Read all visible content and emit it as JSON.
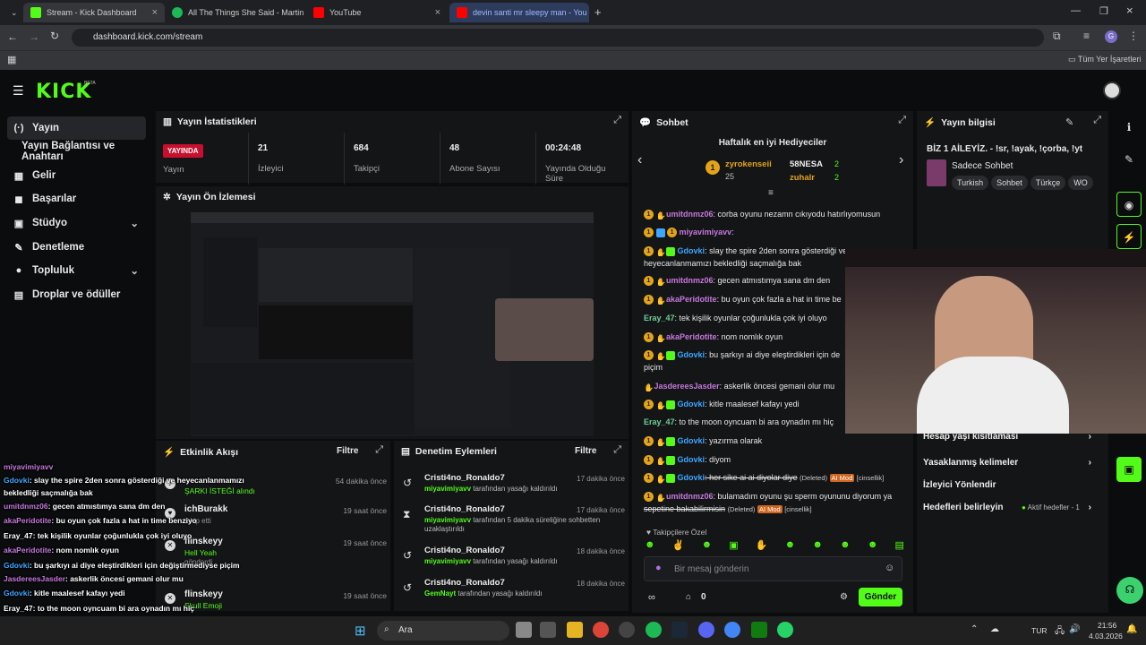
{
  "browser": {
    "tabs": [
      {
        "title": "Stream - Kick Dashboard",
        "color": "#53fc18"
      },
      {
        "title": "All The Things She Said - Martin",
        "color": "#1db954"
      },
      {
        "title": "YouTube",
        "color": "#ff0000"
      },
      {
        "title": "devin santi mr sleepy man - You",
        "color": "#ff0000"
      }
    ],
    "url": "dashboard.kick.com/stream",
    "bookmarks_label": "Tüm Yer İşaretleri",
    "profile_initial": "G"
  },
  "kick": {
    "logo": "KICK",
    "beta": "BETA"
  },
  "sidebar": {
    "items": [
      {
        "label": "Yayın",
        "icon": "(o)"
      },
      {
        "label": "Yayın Bağlantısı ve Anahtarı",
        "icon": ""
      },
      {
        "label": "Gelir",
        "icon": "▦"
      },
      {
        "label": "Başarılar",
        "icon": "◼"
      },
      {
        "label": "Stüdyo",
        "icon": "▣"
      },
      {
        "label": "Denetleme",
        "icon": "🔧"
      },
      {
        "label": "Topluluk",
        "icon": "●"
      },
      {
        "label": "Droplar ve ödüller",
        "icon": "▤"
      }
    ]
  },
  "stats": {
    "title": "Yayın İstatistikleri",
    "live_badge": "YAYINDA",
    "live_label": "Yayın",
    "viewers": "21",
    "viewers_label": "İzleyici",
    "followers": "684",
    "followers_label": "Takipçi",
    "subs": "48",
    "subs_label": "Abone Sayısı",
    "duration": "00:24:48",
    "duration_label": "Yayında Olduğu Süre"
  },
  "preview": {
    "title": "Yayın Ön İzlemesi"
  },
  "activity": {
    "title": "Etkinlik Akışı",
    "filter": "Filtre",
    "items": [
      {
        "name": "",
        "sub": "ŞARKI İSTEĞİ alındı",
        "time": "54 dakika önce"
      },
      {
        "name": "ichBurakk",
        "sub": "",
        "sub2": "takip etti",
        "time": "19 saat önce"
      },
      {
        "name": "flinskeyy",
        "sub": "Hell Yeah",
        "sub2": "gönderdi",
        "time": "19 saat önce"
      },
      {
        "name": "flinskeyy",
        "sub": "Skull Emoji",
        "sub2": "",
        "time": "19 saat önce"
      }
    ]
  },
  "moderation": {
    "title": "Denetim Eylemleri",
    "filter": "Filtre",
    "items": [
      {
        "name": "Cristi4no_Ronaldo7",
        "user": "miyavimiyavv",
        "text": "tarafından yasağı kaldırıldı",
        "time": "17 dakika önce",
        "icon": "↺"
      },
      {
        "name": "Cristi4no_Ronaldo7",
        "user": "miyavimiyavv",
        "text": "tarafından 5 dakika süreliğine sohbetten uzaklaştırıldı",
        "time": "17 dakika önce",
        "icon": "⧗"
      },
      {
        "name": "Cristi4no_Ronaldo7",
        "user": "miyavimiyavv",
        "text": "tarafından yasağı kaldırıldı",
        "time": "18 dakika önce",
        "icon": "↺"
      },
      {
        "name": "Cristi4no_Ronaldo7",
        "user": "GemNayt",
        "text": "tarafından yasağı kaldırıldı",
        "time": "18 dakika önce",
        "icon": "↺"
      }
    ]
  },
  "chat": {
    "title": "Sohbet",
    "gifters_title": "Haftalık en iyi Hediyeciler",
    "gifter1": "zyrokenseii",
    "gifter1_count": "25",
    "gifter2": "58NESA",
    "gifter2_count": "2",
    "gifter3": "zuhalr",
    "gifter3_count": "2",
    "messages": [
      {
        "user": "umitdnmz06",
        "color": "#c678dd",
        "text": ": corba oyunu nezamn cıkıyodu hatırlıyomusun",
        "b": "12"
      },
      {
        "user": "miyavimiyavv",
        "color": "#c678dd",
        "text": ":",
        "b": "x1"
      },
      {
        "user": "Gdovki",
        "color": "#3ea6ff",
        "text": ": slay the spire 2den sonra gösterdiği ve",
        "b": "123"
      },
      {
        "user": "",
        "color": "#fff",
        "text": "heyecanlanmamızı bekledliği saçmalığa bak",
        "b": ""
      },
      {
        "user": "umitdnmz06",
        "color": "#c678dd",
        "text": ": gecen atmıstımya sana dm den",
        "b": "12"
      },
      {
        "user": "akaPeridotite",
        "color": "#c678dd",
        "text": ": bu oyun çok fazla a hat in time be",
        "b": "12"
      },
      {
        "user": "Eray_47",
        "color": "#6fcf97",
        "text": ": tek kişilik oyunlar çoğunlukla çok iyi oluyo",
        "b": ""
      },
      {
        "user": "akaPeridotite",
        "color": "#c678dd",
        "text": ": nom nomlık oyun",
        "b": "12"
      },
      {
        "user": "Gdovki",
        "color": "#3ea6ff",
        "text": ": bu şarkıyı ai diye eleştirdikleri için de",
        "b": "123"
      },
      {
        "user": "",
        "color": "#fff",
        "text": "piçim",
        "b": ""
      },
      {
        "user": "JasdereesJasder",
        "color": "#c678dd",
        "text": ": askerlik öncesi gemani olur mu",
        "b": "2"
      },
      {
        "user": "Gdovki",
        "color": "#3ea6ff",
        "text": ": kitle maalesef kafayı yedi",
        "b": "123"
      },
      {
        "user": "Eray_47",
        "color": "#6fcf97",
        "text": ": to the moon oyncuam bi ara oynadın mı hiç",
        "b": ""
      },
      {
        "user": "Gdovki",
        "color": "#3ea6ff",
        "text": ": yazırma olarak",
        "b": "123"
      },
      {
        "user": "Gdovki",
        "color": "#3ea6ff",
        "text": ": diyom",
        "b": "123"
      },
      {
        "user": "Gdovki",
        "color": "#3ea6ff",
        "text": ": her sike ai ai diyolar diye",
        "b": "123",
        "deleted": "(Deleted)",
        "aimod": "AI Mod",
        "flag": "[cinsellik]"
      },
      {
        "user": "umitdnmz06",
        "color": "#c678dd",
        "text": ": bulamadım oyunu şu sperm oyununu diyorum ya",
        "b": "12"
      },
      {
        "user": "",
        "color": "#fff",
        "text": "sepetine bakabilirmisin",
        "b": "",
        "deleted": "(Deleted)",
        "aimod": "AI Mod",
        "flag": "[cinsellik]"
      }
    ],
    "followers_only": "Takipçilere Özel",
    "placeholder": "Bir mesaj gönderin",
    "points": "0",
    "send": "Gönder"
  },
  "info": {
    "title": "Yayın bilgisi",
    "stream_title": "BİZ 1 AİLEYİZ. - !sr, !ayak, !çorba, !yt",
    "category": "Sadece Sohbet",
    "tags": [
      "Turkish",
      "Sohbet",
      "Türkçe",
      "WO"
    ],
    "rows": [
      {
        "label": "Hesap yaşı kısıtlaması"
      },
      {
        "label": "Yasaklanmış kelimeler"
      },
      {
        "label": "İzleyici Yönlendir"
      },
      {
        "label": "Hedefleri belirleyin",
        "extra": "Aktif hedefler - 1"
      }
    ]
  },
  "overlay_chat": [
    {
      "user": "miyavimiyavv",
      "text": ""
    },
    {
      "user": "Gdovki",
      "text": ": slay the spire 2den sonra gösterdiği ve heyecanlanmamızı"
    },
    {
      "user": "",
      "text": "bekledliği saçmalığa bak"
    },
    {
      "user": "umitdnmz06",
      "text": ": gecen atmıstımya sana dm den"
    },
    {
      "user": "akaPeridotite",
      "text": ": bu oyun çok fazla a hat in time benziyo"
    },
    {
      "user": "Eray_47",
      "text": ": tek kişilik oyunlar çoğunlukla çok iyi oluyo"
    },
    {
      "user": "akaPeridotite",
      "text": ": nom nomlık oyun"
    },
    {
      "user": "Gdovki",
      "text": ": bu şarkıyı ai diye eleştirdikleri için değiştirmediyse piçim"
    },
    {
      "user": "JasdereesJasder",
      "text": ": askerlik öncesi gemani olur mu"
    },
    {
      "user": "Gdovki",
      "text": ": kitle maalesef kafayı yedi"
    },
    {
      "user": "Eray_47",
      "text": ": to the moon oyncuam bi ara oynadın mı hiç"
    },
    {
      "user": "Gdovki",
      "text": ": yazırma olarak"
    },
    {
      "user": "Gdovki",
      "text": ": diyom"
    }
  ],
  "taskbar": {
    "search": "Ara",
    "lang": "TUR",
    "time": "21:56",
    "date": "4.03.2026"
  }
}
